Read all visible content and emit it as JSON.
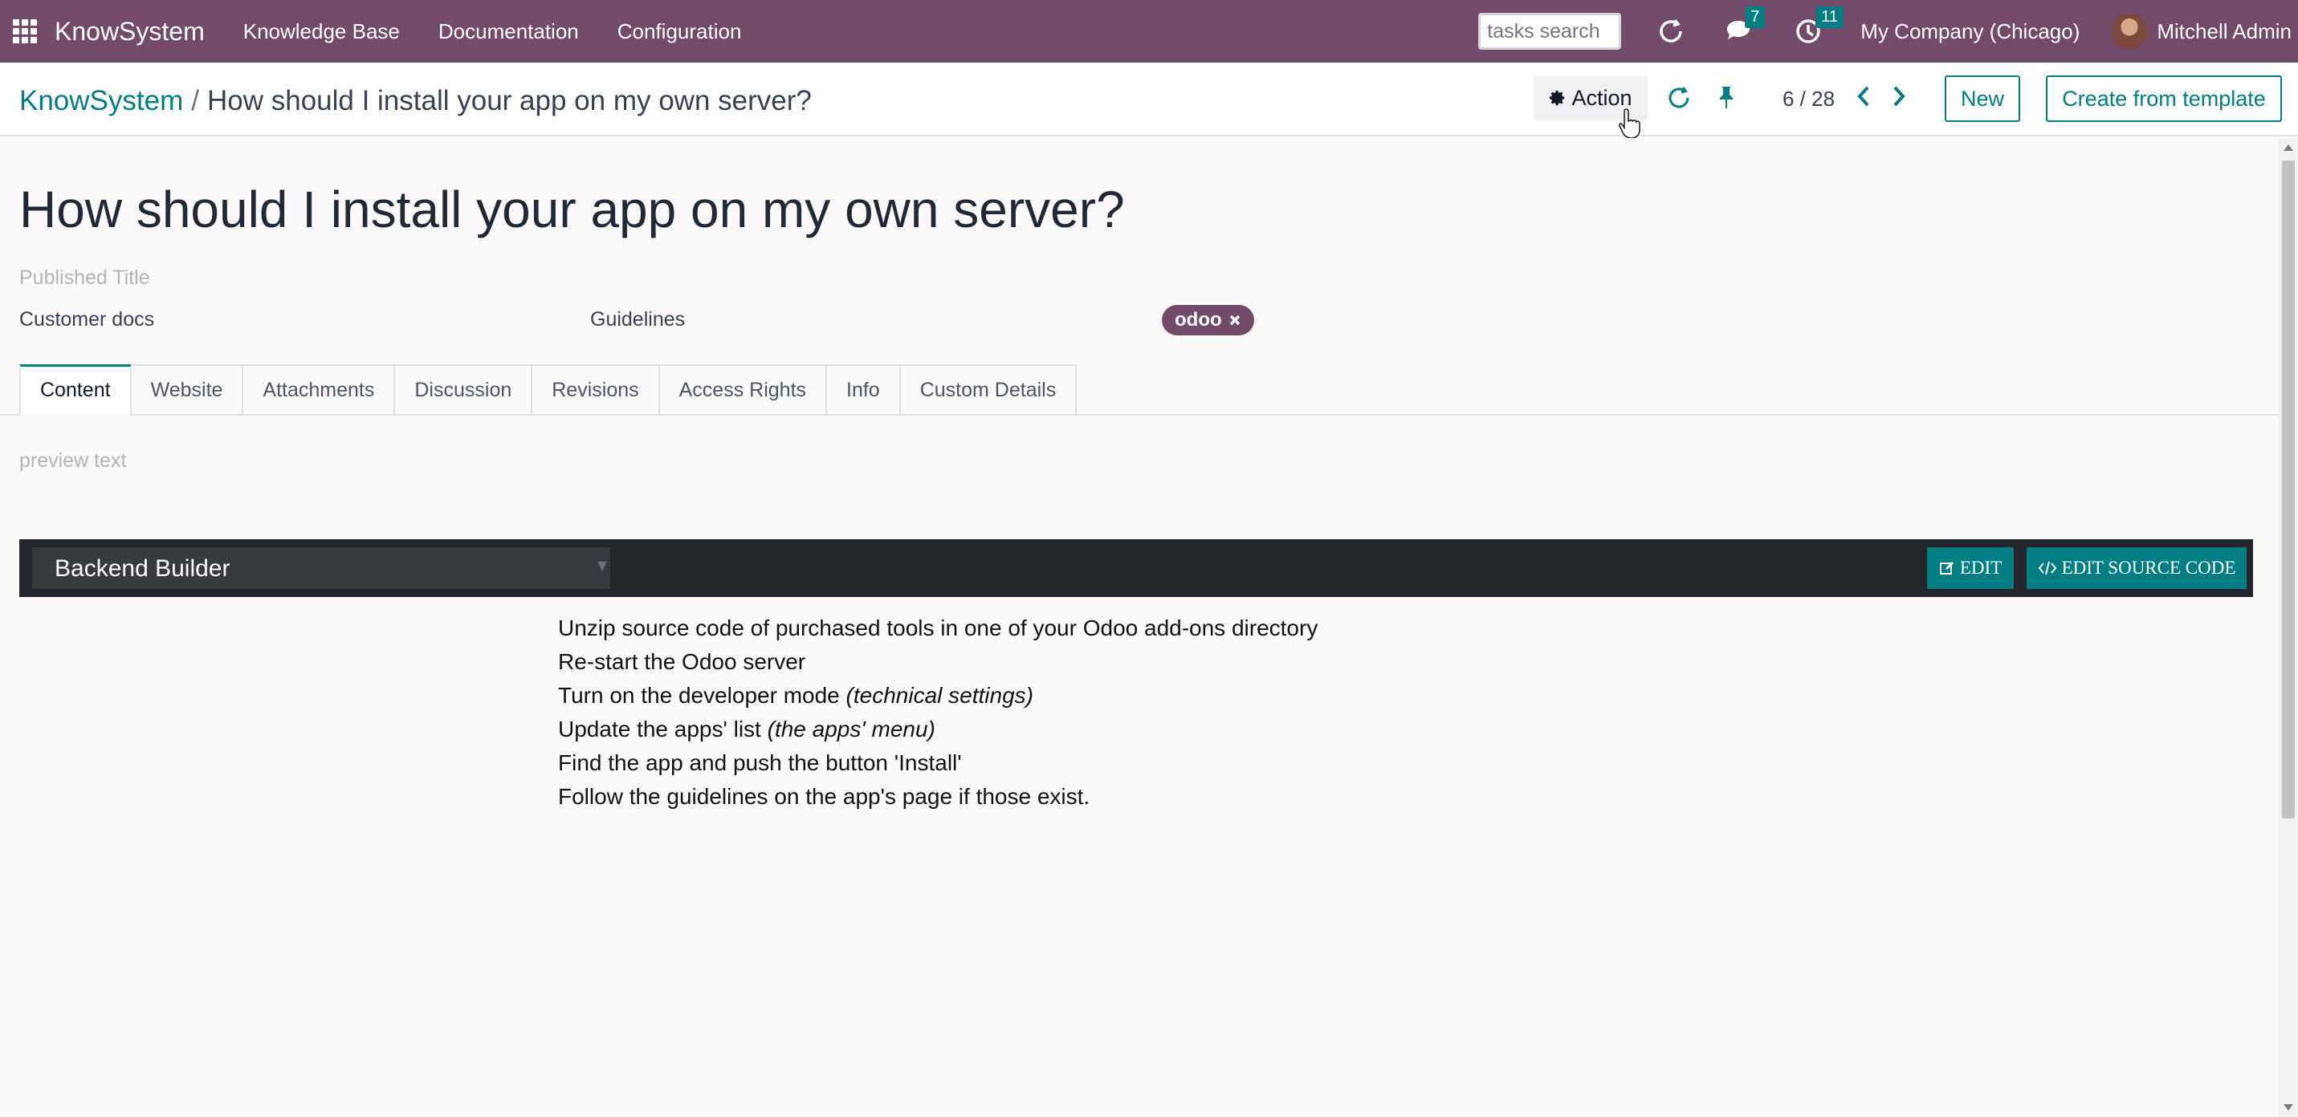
{
  "navbar": {
    "apps_icon": "grid-icon",
    "brand": "KnowSystem",
    "menu": [
      "Knowledge Base",
      "Documentation",
      "Configuration"
    ],
    "search_placeholder": "tasks search",
    "messages_badge": "7",
    "activities_badge": "11",
    "company": "My Company (Chicago)",
    "user": "Mitchell Admin"
  },
  "control": {
    "breadcrumb_root": "KnowSystem",
    "breadcrumb_separator": "/",
    "breadcrumb_current": "How should I install your app on my own server?",
    "action_label": "Action",
    "pager": "6 / 28",
    "new_label": "New",
    "create_template_label": "Create from template"
  },
  "form": {
    "title": "How should I install your app on my own server?",
    "published_title_placeholder": "Published Title",
    "section": "Customer docs",
    "type": "Guidelines",
    "tag": "odoo",
    "tabs": [
      "Content",
      "Website",
      "Attachments",
      "Discussion",
      "Revisions",
      "Access Rights",
      "Info",
      "Custom Details"
    ],
    "active_tab": "Content",
    "preview_placeholder": "preview text",
    "editor": {
      "snippet": "Backend Builder",
      "edit_label": "EDIT",
      "edit_source_label": "EDIT SOURCE CODE"
    },
    "steps": [
      {
        "text": "Unzip source code of purchased tools in one of your Odoo add-ons directory",
        "note": ""
      },
      {
        "text": "Re-start the Odoo server",
        "note": ""
      },
      {
        "text": "Turn on the developer mode ",
        "note": "(technical settings)"
      },
      {
        "text": "Update the apps' list ",
        "note": "(the apps' menu)"
      },
      {
        "text": "Find the app and push the button 'Install'",
        "note": ""
      },
      {
        "text": "Follow the guidelines on the app's page if those exist.",
        "note": ""
      }
    ]
  },
  "colors": {
    "brand_purple": "#714b67",
    "accent_teal": "#017e84",
    "editor_dark": "#23272b"
  }
}
